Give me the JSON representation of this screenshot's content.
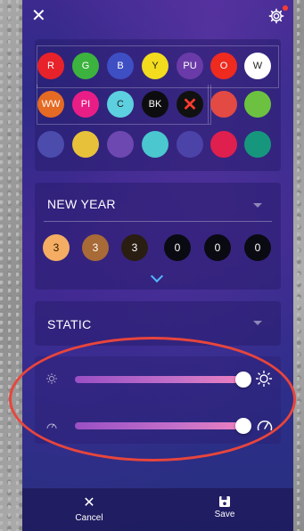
{
  "topbar": {
    "close_glyph": "✕",
    "settings_icon": "gear-icon"
  },
  "palette": {
    "row1": [
      {
        "label": "R",
        "color": "#e8222a"
      },
      {
        "label": "G",
        "color": "#3cb33e"
      },
      {
        "label": "B",
        "color": "#3e4fc4"
      },
      {
        "label": "Y",
        "color": "#f2dc1d",
        "text": "#222"
      },
      {
        "label": "PU",
        "color": "#6a3ba8"
      },
      {
        "label": "O",
        "color": "#ef2a1f"
      },
      {
        "label": "W",
        "color": "#ffffff",
        "text": "#222"
      }
    ],
    "row2": [
      {
        "label": "WW",
        "color": "#e56a23"
      },
      {
        "label": "PI",
        "color": "#e81e86"
      },
      {
        "label": "C",
        "color": "#5dd0e0",
        "text": "#222"
      },
      {
        "label": "BK",
        "color": "#0d0d10"
      },
      {
        "label": "✕",
        "color": "#111111",
        "text": "#ff3b30"
      },
      {
        "label": "",
        "color": "#e24a43"
      },
      {
        "label": "",
        "color": "#6cc240"
      }
    ],
    "row3": [
      {
        "label": "",
        "color": "#4b4cac"
      },
      {
        "label": "",
        "color": "#e8c13a"
      },
      {
        "label": "",
        "color": "#6d48b0"
      },
      {
        "label": "",
        "color": "#4ac7cf"
      },
      {
        "label": "",
        "color": "#4b43a8"
      },
      {
        "label": "",
        "color": "#df1f4e"
      },
      {
        "label": "",
        "color": "#16977d"
      }
    ]
  },
  "scene": {
    "title": "NEW YEAR",
    "counts": [
      {
        "value": "3",
        "color": "#f4ad63",
        "text": "#2a1a00"
      },
      {
        "value": "3",
        "color": "#a86a36",
        "text": "#fff"
      },
      {
        "value": "3",
        "color": "#2a1d12",
        "text": "#fff"
      },
      {
        "value": "0",
        "color": "#0a0a12",
        "text": "#fff"
      },
      {
        "value": "0",
        "color": "#0a0a12",
        "text": "#fff"
      },
      {
        "value": "0",
        "color": "#0a0a12",
        "text": "#fff"
      }
    ]
  },
  "mode": {
    "title": "STATIC"
  },
  "sliders": {
    "brightness": {
      "value_fraction": 1.0,
      "icon_low": "sun-small-icon",
      "icon_high": "sun-large-icon"
    },
    "speed": {
      "value_fraction": 1.0,
      "icon_low": "speed-small-icon",
      "icon_high": "speedometer-icon"
    }
  },
  "bottom": {
    "cancel_label": "Cancel",
    "cancel_glyph": "✕",
    "save_label": "Save",
    "save_glyph": "💾"
  },
  "colors": {
    "highlight_ellipse": "#e8453c"
  }
}
